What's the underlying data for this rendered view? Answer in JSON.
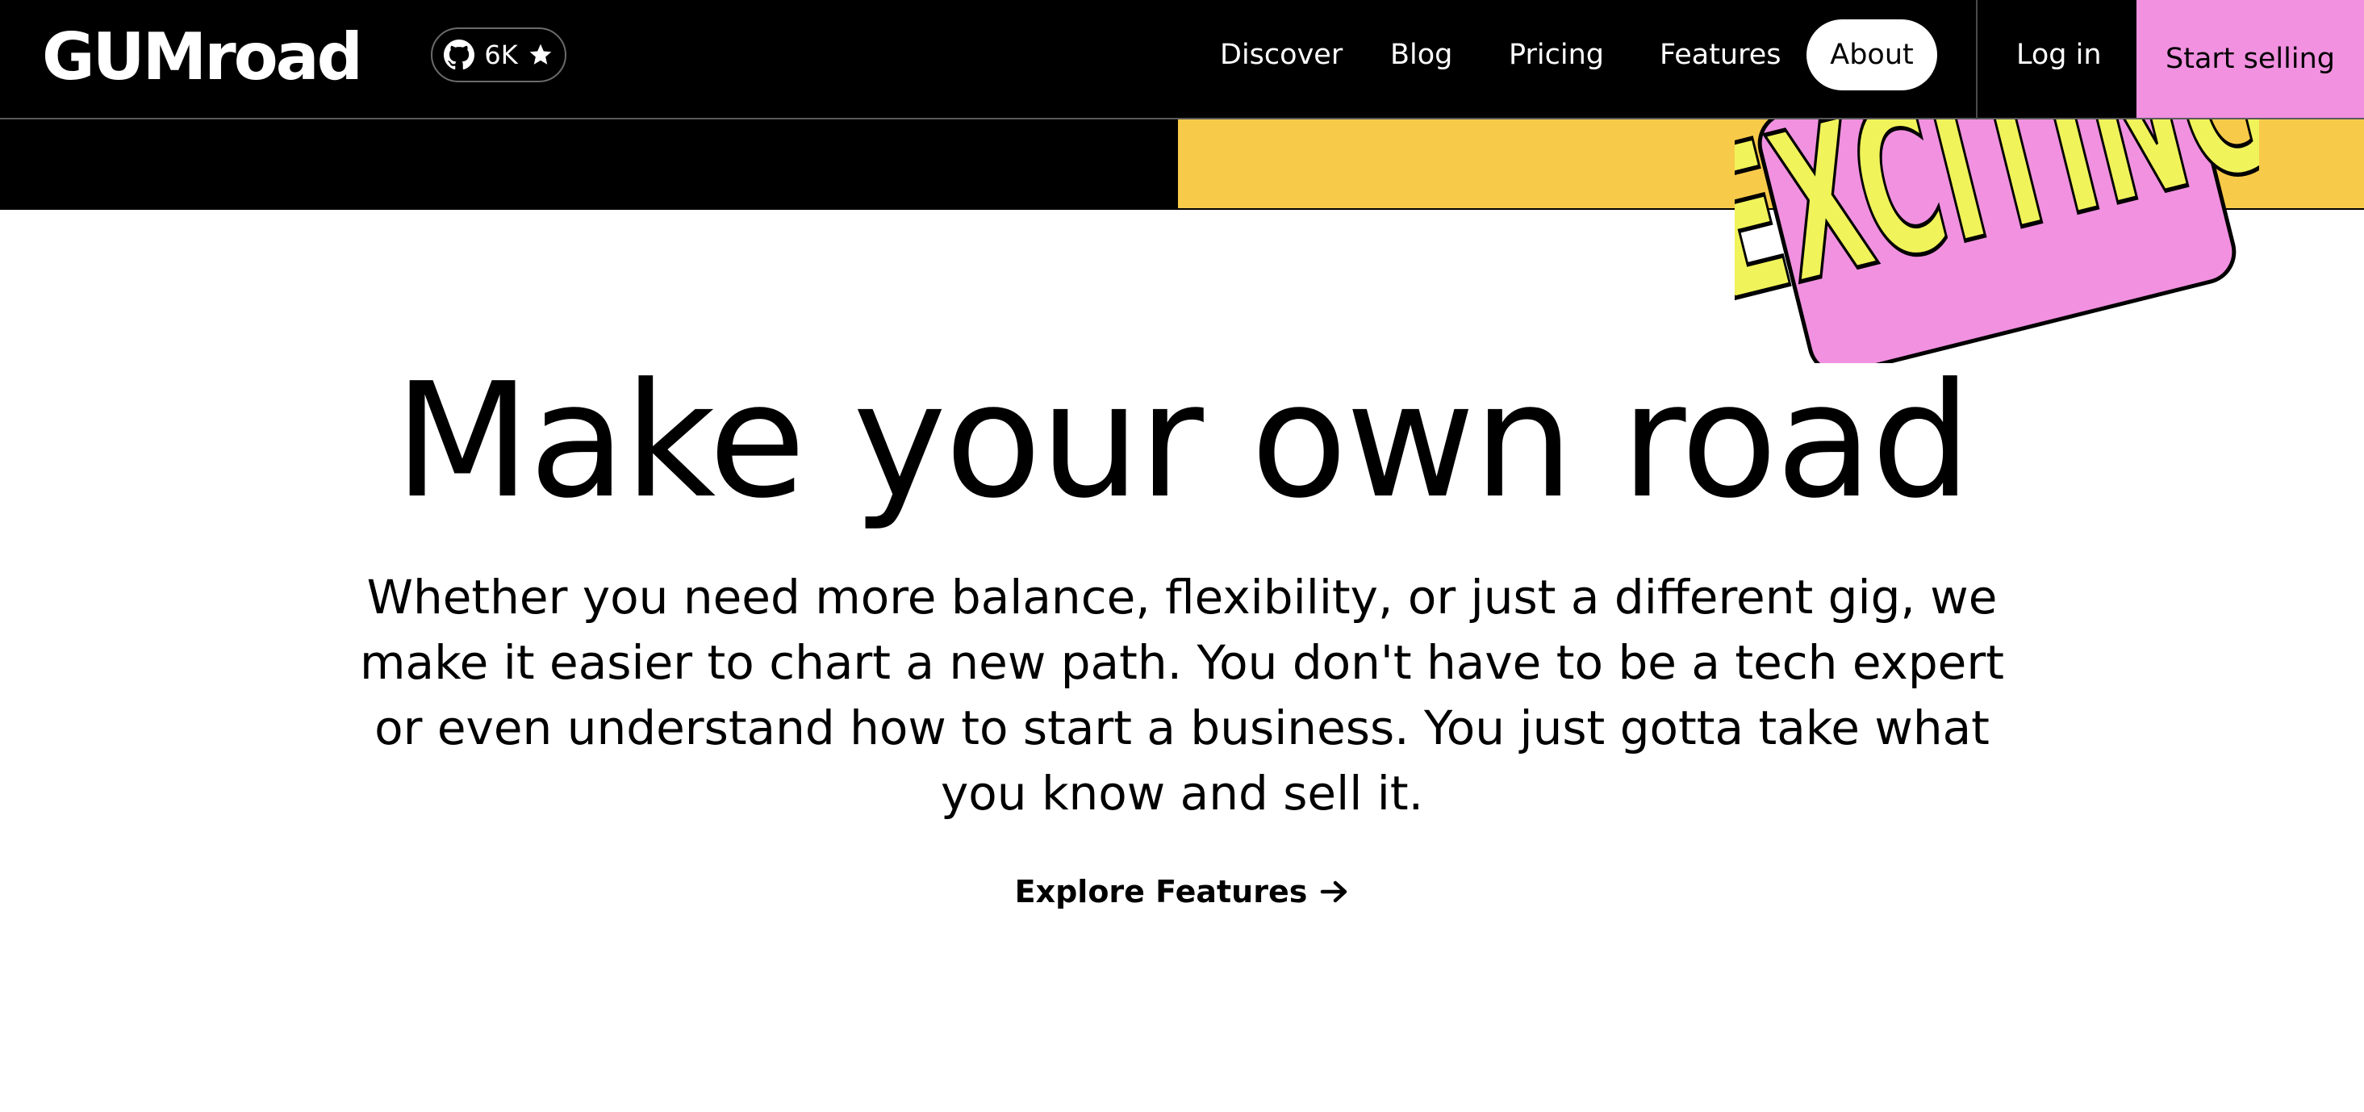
{
  "header": {
    "logo": "GUMroad",
    "github": {
      "count": "6K",
      "icons": [
        "github-icon",
        "star-icon"
      ]
    },
    "nav": [
      "Discover",
      "Blog",
      "Pricing",
      "Features",
      "About"
    ],
    "active_nav": "About",
    "login_label": "Log in",
    "start_selling_label": "Start selling"
  },
  "sticker": {
    "text": "EXCITING"
  },
  "hero": {
    "title": "Make your own road",
    "body": "Whether you need more balance, flexibility, or just a different gig, we make it easier to chart a new path. You don't have to be a tech expert or even understand how to start a business. You just gotta take what you know and sell it.",
    "cta_label": "Explore Features",
    "cta_icon": "arrow-right-icon"
  },
  "colors": {
    "header_bg": "#000000",
    "banner_yellow": "#f8ca4a",
    "accent_pink": "#f191e0",
    "sticker_text": "#f0f35a"
  }
}
